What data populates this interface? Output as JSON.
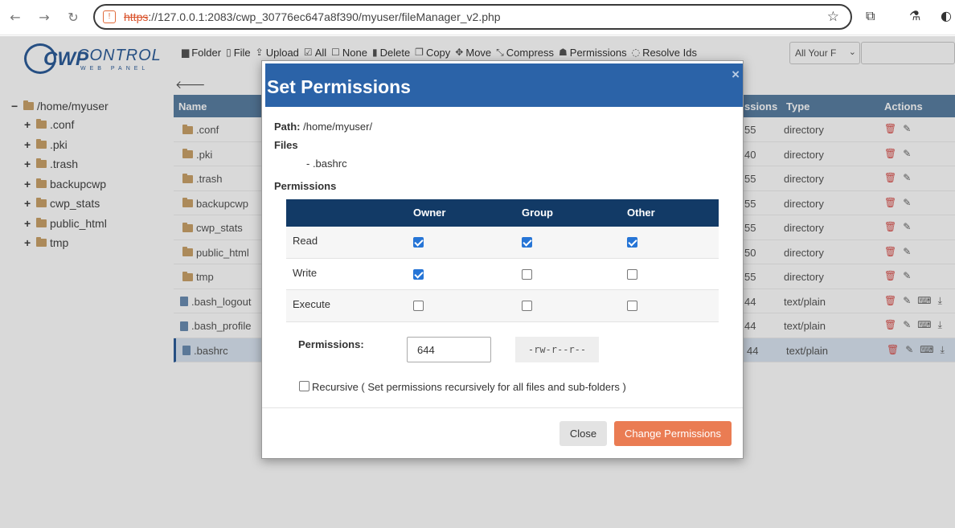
{
  "browser": {
    "url_scheme": "https",
    "url_rest": "://127.0.0.1:2083/cwp_30776ec647a8f390/myuser/fileManager_v2.php"
  },
  "logo": {
    "brand": "CWP",
    "control": "CONTROL",
    "sub": "WEB PANEL"
  },
  "toolbar": [
    {
      "label": "Folder",
      "icon": "folder-icon",
      "glyph": "▆"
    },
    {
      "label": "File",
      "icon": "file-icon",
      "glyph": "▯"
    },
    {
      "label": "Upload",
      "icon": "upload-icon",
      "glyph": "⇪"
    },
    {
      "label": "All",
      "icon": "check-all-icon",
      "glyph": "☑"
    },
    {
      "label": "None",
      "icon": "check-none-icon",
      "glyph": "☐"
    },
    {
      "label": "Delete",
      "icon": "trash-icon",
      "glyph": "▮"
    },
    {
      "label": "Copy",
      "icon": "copy-icon",
      "glyph": "❐"
    },
    {
      "label": "Move",
      "icon": "move-icon",
      "glyph": "✥"
    },
    {
      "label": "Compress",
      "icon": "compress-icon",
      "glyph": "⤡"
    },
    {
      "label": "Permissions",
      "icon": "users-icon",
      "glyph": "☗"
    },
    {
      "label": "Resolve Ids",
      "icon": "refresh-icon",
      "glyph": "◌"
    }
  ],
  "filter_select": "All Your F",
  "tree": {
    "root": "/home/myuser",
    "items": [
      ".conf",
      ".pki",
      ".trash",
      "backupcwp",
      "cwp_stats",
      "public_html",
      "tmp"
    ]
  },
  "table": {
    "headers": {
      "name": "Name",
      "perm": "ssions",
      "type": "Type",
      "actions": "Actions"
    },
    "rows": [
      {
        "name": ".conf",
        "perm": "55",
        "type": "directory",
        "kind": "folder"
      },
      {
        "name": ".pki",
        "perm": "40",
        "type": "directory",
        "kind": "folder"
      },
      {
        "name": ".trash",
        "perm": "55",
        "type": "directory",
        "kind": "folder"
      },
      {
        "name": "backupcwp",
        "perm": "55",
        "type": "directory",
        "kind": "folder"
      },
      {
        "name": "cwp_stats",
        "perm": "55",
        "type": "directory",
        "kind": "folder"
      },
      {
        "name": "public_html",
        "perm": "50",
        "type": "directory",
        "kind": "folder"
      },
      {
        "name": "tmp",
        "perm": "55",
        "type": "directory",
        "kind": "folder"
      },
      {
        "name": ".bash_logout",
        "perm": "44",
        "type": "text/plain",
        "kind": "file"
      },
      {
        "name": ".bash_profile",
        "perm": "44",
        "type": "text/plain",
        "kind": "file"
      },
      {
        "name": ".bashrc",
        "perm": "44",
        "type": "text/plain",
        "kind": "file",
        "selected": true
      }
    ]
  },
  "modal": {
    "title": "Set Permissions",
    "close_glyph": "×",
    "path_label": "Path:",
    "path_value": "/home/myuser/",
    "files_label": "Files",
    "file_item": "- .bashrc",
    "perms_label": "Permissions",
    "columns": [
      "Owner",
      "Group",
      "Other"
    ],
    "rows": [
      {
        "label": "Read",
        "checks": [
          true,
          true,
          true
        ]
      },
      {
        "label": "Write",
        "checks": [
          true,
          false,
          false
        ]
      },
      {
        "label": "Execute",
        "checks": [
          false,
          false,
          false
        ]
      }
    ],
    "permissions_field_label": "Permissions:",
    "permissions_value": "644",
    "permissions_string": "-rw-r--r--",
    "recursive_label": "Recursive ( Set permissions recursively for all files and sub-folders )",
    "recursive_checked": false,
    "close_button": "Close",
    "change_button": "Change Permissions"
  },
  "colors": {
    "modal_header": "#2b63a8",
    "table_header": "#123a66",
    "primary_button": "#ea7c53",
    "checkbox_checked": "#2675d6"
  }
}
